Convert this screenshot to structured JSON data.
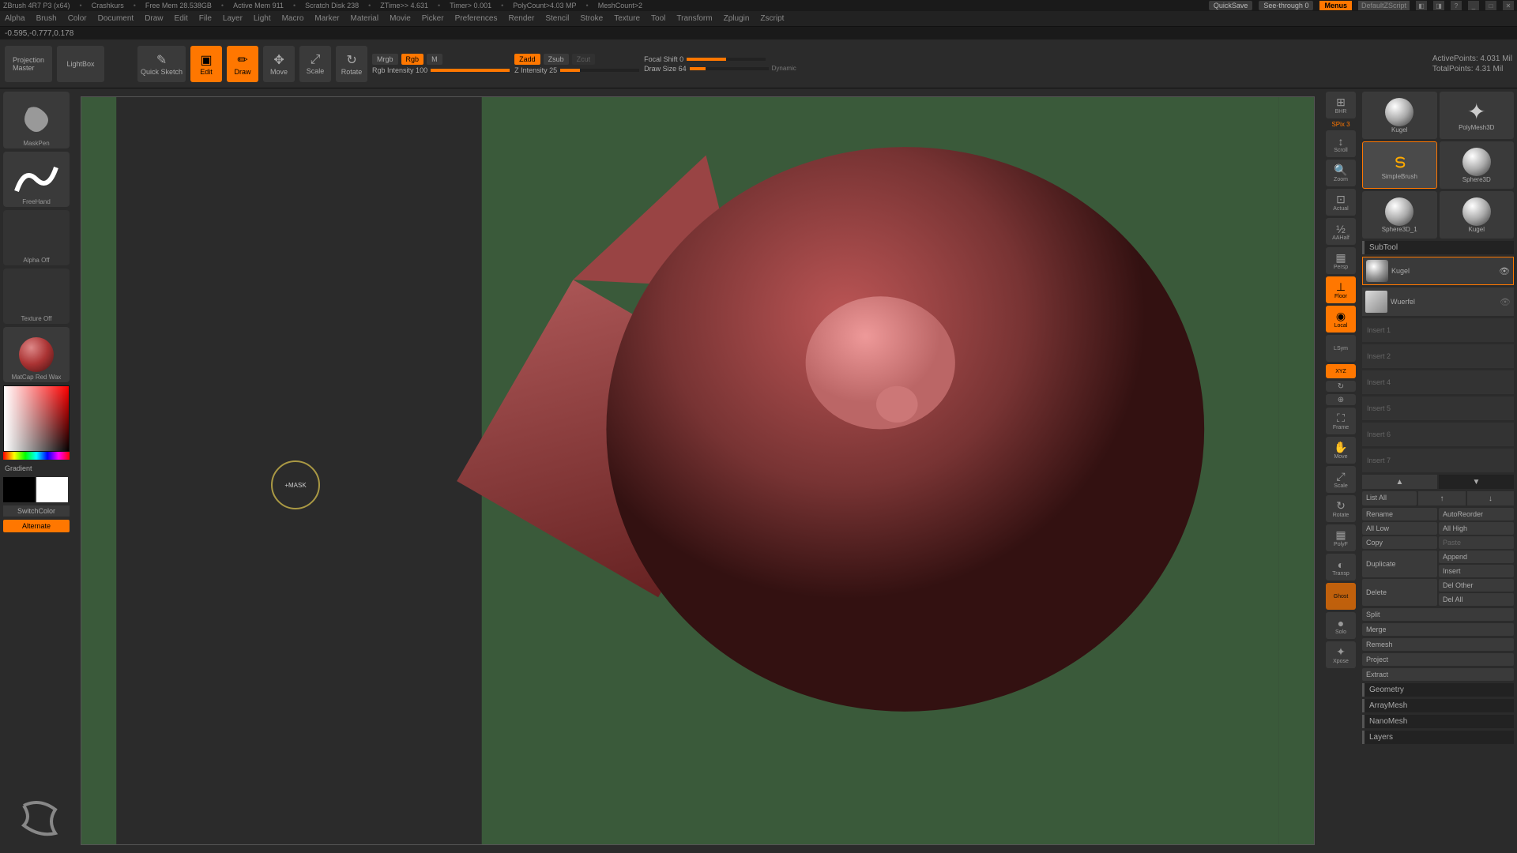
{
  "title": {
    "app": "ZBrush 4R7 P3 (x64)",
    "doc": "Crashkurs",
    "freemem": "Free Mem 28.538GB",
    "activemem": "Active Mem 911",
    "scratch": "Scratch Disk 238",
    "ztime": "ZTime>> 4.631",
    "timer": "Timer> 0.001",
    "polycount": "PolyCount>4.03 MP",
    "meshcount": "MeshCount>2",
    "quicksave": "QuickSave",
    "seethrough": "See-through  0",
    "menus": "Menus",
    "defscript": "DefaultZScript"
  },
  "menubar": [
    "Alpha",
    "Brush",
    "Color",
    "Document",
    "Draw",
    "Edit",
    "File",
    "Layer",
    "Light",
    "Macro",
    "Marker",
    "Material",
    "Movie",
    "Picker",
    "Preferences",
    "Render",
    "Stencil",
    "Stroke",
    "Texture",
    "Tool",
    "Transform",
    "Zplugin",
    "Zscript"
  ],
  "xyz": "-0.595,-0.777,0.178",
  "toolbar": {
    "projection": "Projection\nMaster",
    "lightbox": "LightBox",
    "quicksketch": "Quick Sketch",
    "edit": "Edit",
    "draw": "Draw",
    "move": "Move",
    "scale": "Scale",
    "rotate": "Rotate",
    "mrgb": "Mrgb",
    "rgb": "Rgb",
    "m": "M",
    "rgbint": "Rgb Intensity 100",
    "zadd": "Zadd",
    "zsub": "Zsub",
    "zcut": "Zcut",
    "zint": "Z Intensity 25",
    "focal": "Focal Shift 0",
    "drawsize": "Draw Size 64",
    "dynamic": "Dynamic",
    "active": "ActivePoints: 4.031 Mil",
    "total": "TotalPoints: 4.31 Mil"
  },
  "left": {
    "brush": "MaskPen",
    "stroke": "FreeHand",
    "alpha": "Alpha Off",
    "texture": "Texture Off",
    "material": "MatCap Red Wax",
    "gradient": "Gradient",
    "switch": "SwitchColor",
    "alternate": "Alternate"
  },
  "cursor": "+MASK",
  "rside": {
    "spix": "SPix 3",
    "items": [
      "BHR",
      "Scroll",
      "Zoom",
      "Actual",
      "AAHalf",
      "Persp",
      "Floor",
      "Local",
      "LSym",
      "XYZ",
      "Frame",
      "Move",
      "Scale",
      "Rotate",
      "PolyF",
      "Transp",
      "Ghost",
      "Solo",
      "Xpose"
    ]
  },
  "tools": {
    "names": [
      "Kugel",
      "PolyMesh3D",
      "SimpleBrush",
      "Sphere3D",
      "Sphere3D_1",
      "Kugel"
    ]
  },
  "subtool": {
    "header": "SubTool",
    "items": [
      {
        "name": "Kugel",
        "sel": true
      },
      {
        "name": "Wuerfel",
        "sel": false
      }
    ],
    "empty": [
      "Insert 1",
      "Insert 2",
      "Insert 4",
      "Insert 5",
      "Insert 6",
      "Insert 7"
    ],
    "listall": "List All",
    "actions": {
      "rename": "Rename",
      "autoreorder": "AutoReorder",
      "alllow": "All Low",
      "allhigh": "All High",
      "copy": "Copy",
      "paste": "Paste",
      "duplicate": "Duplicate",
      "append": "Append",
      "insert": "Insert",
      "delete": "Delete",
      "delother": "Del Other",
      "delall": "Del All",
      "split": "Split",
      "merge": "Merge",
      "remesh": "Remesh",
      "project": "Project",
      "extract": "Extract"
    },
    "sections": [
      "Geometry",
      "ArrayMesh",
      "NanoMesh",
      "Layers"
    ]
  }
}
